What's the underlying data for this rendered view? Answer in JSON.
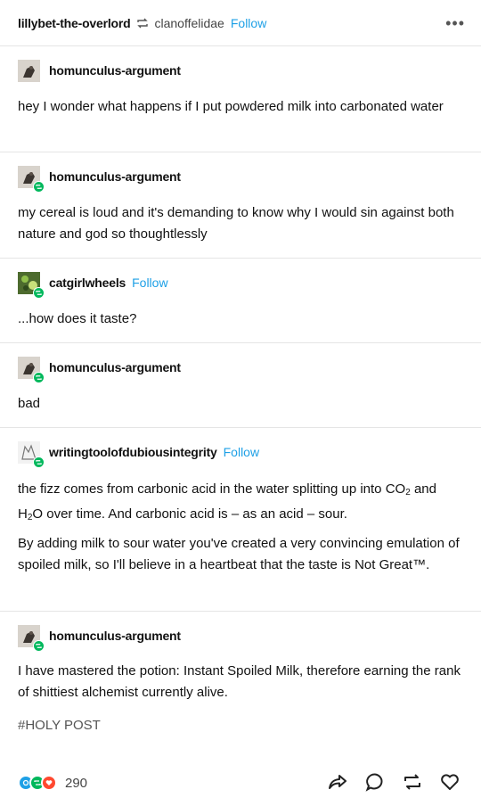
{
  "header": {
    "reblogger": "lillybet-the-overlord",
    "source": "clanoffelidae",
    "follow_label": "Follow",
    "more_label": "•••"
  },
  "posts": [
    {
      "username": "homunculus-argument",
      "text": "hey I wonder what happens if I put powdered milk into carbonated water"
    },
    {
      "username": "homunculus-argument",
      "text": "my cereal is loud and it's demanding to know why I would sin against both nature and god so thoughtlessly"
    },
    {
      "username": "catgirlwheels",
      "follow_label": "Follow",
      "text": "...how does it taste?"
    },
    {
      "username": "homunculus-argument",
      "text": "bad"
    },
    {
      "username": "writingtoolofdubiousintegrity",
      "follow_label": "Follow",
      "p1_a": "the fizz comes from carbonic acid in the water splitting up into CO",
      "p1_sub1": "2",
      "p1_b": "and H",
      "p1_sub2": "2",
      "p1_c": "O over time. And carbonic acid is – as an acid – sour.",
      "p2": "By adding milk to sour water you've created a very convincing emulation of spoiled milk, so I'll believe in a heartbeat that the taste is Not Great™."
    },
    {
      "username": "homunculus-argument",
      "text": "I have mastered the potion: Instant Spoiled Milk, therefore earning the rank of shittiest alchemist currently alive.",
      "tag": "#HOLY POST"
    }
  ],
  "footer": {
    "notes_count": "290",
    "icons": [
      "share-icon",
      "reply-icon",
      "reblog-icon",
      "like-icon"
    ],
    "note_colors": {
      "reply": "#1ea0e6",
      "reblog": "#00b85c",
      "like": "#ff4930"
    }
  }
}
